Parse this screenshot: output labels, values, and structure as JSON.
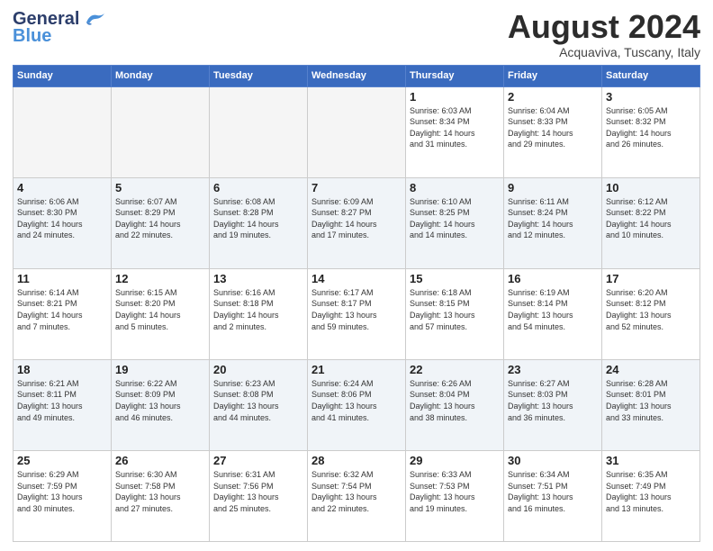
{
  "logo": {
    "line1": "General",
    "line2": "Blue"
  },
  "header": {
    "title": "August 2024",
    "subtitle": "Acquaviva, Tuscany, Italy"
  },
  "weekdays": [
    "Sunday",
    "Monday",
    "Tuesday",
    "Wednesday",
    "Thursday",
    "Friday",
    "Saturday"
  ],
  "weeks": [
    [
      {
        "day": "",
        "info": ""
      },
      {
        "day": "",
        "info": ""
      },
      {
        "day": "",
        "info": ""
      },
      {
        "day": "",
        "info": ""
      },
      {
        "day": "1",
        "info": "Sunrise: 6:03 AM\nSunset: 8:34 PM\nDaylight: 14 hours\nand 31 minutes."
      },
      {
        "day": "2",
        "info": "Sunrise: 6:04 AM\nSunset: 8:33 PM\nDaylight: 14 hours\nand 29 minutes."
      },
      {
        "day": "3",
        "info": "Sunrise: 6:05 AM\nSunset: 8:32 PM\nDaylight: 14 hours\nand 26 minutes."
      }
    ],
    [
      {
        "day": "4",
        "info": "Sunrise: 6:06 AM\nSunset: 8:30 PM\nDaylight: 14 hours\nand 24 minutes."
      },
      {
        "day": "5",
        "info": "Sunrise: 6:07 AM\nSunset: 8:29 PM\nDaylight: 14 hours\nand 22 minutes."
      },
      {
        "day": "6",
        "info": "Sunrise: 6:08 AM\nSunset: 8:28 PM\nDaylight: 14 hours\nand 19 minutes."
      },
      {
        "day": "7",
        "info": "Sunrise: 6:09 AM\nSunset: 8:27 PM\nDaylight: 14 hours\nand 17 minutes."
      },
      {
        "day": "8",
        "info": "Sunrise: 6:10 AM\nSunset: 8:25 PM\nDaylight: 14 hours\nand 14 minutes."
      },
      {
        "day": "9",
        "info": "Sunrise: 6:11 AM\nSunset: 8:24 PM\nDaylight: 14 hours\nand 12 minutes."
      },
      {
        "day": "10",
        "info": "Sunrise: 6:12 AM\nSunset: 8:22 PM\nDaylight: 14 hours\nand 10 minutes."
      }
    ],
    [
      {
        "day": "11",
        "info": "Sunrise: 6:14 AM\nSunset: 8:21 PM\nDaylight: 14 hours\nand 7 minutes."
      },
      {
        "day": "12",
        "info": "Sunrise: 6:15 AM\nSunset: 8:20 PM\nDaylight: 14 hours\nand 5 minutes."
      },
      {
        "day": "13",
        "info": "Sunrise: 6:16 AM\nSunset: 8:18 PM\nDaylight: 14 hours\nand 2 minutes."
      },
      {
        "day": "14",
        "info": "Sunrise: 6:17 AM\nSunset: 8:17 PM\nDaylight: 13 hours\nand 59 minutes."
      },
      {
        "day": "15",
        "info": "Sunrise: 6:18 AM\nSunset: 8:15 PM\nDaylight: 13 hours\nand 57 minutes."
      },
      {
        "day": "16",
        "info": "Sunrise: 6:19 AM\nSunset: 8:14 PM\nDaylight: 13 hours\nand 54 minutes."
      },
      {
        "day": "17",
        "info": "Sunrise: 6:20 AM\nSunset: 8:12 PM\nDaylight: 13 hours\nand 52 minutes."
      }
    ],
    [
      {
        "day": "18",
        "info": "Sunrise: 6:21 AM\nSunset: 8:11 PM\nDaylight: 13 hours\nand 49 minutes."
      },
      {
        "day": "19",
        "info": "Sunrise: 6:22 AM\nSunset: 8:09 PM\nDaylight: 13 hours\nand 46 minutes."
      },
      {
        "day": "20",
        "info": "Sunrise: 6:23 AM\nSunset: 8:08 PM\nDaylight: 13 hours\nand 44 minutes."
      },
      {
        "day": "21",
        "info": "Sunrise: 6:24 AM\nSunset: 8:06 PM\nDaylight: 13 hours\nand 41 minutes."
      },
      {
        "day": "22",
        "info": "Sunrise: 6:26 AM\nSunset: 8:04 PM\nDaylight: 13 hours\nand 38 minutes."
      },
      {
        "day": "23",
        "info": "Sunrise: 6:27 AM\nSunset: 8:03 PM\nDaylight: 13 hours\nand 36 minutes."
      },
      {
        "day": "24",
        "info": "Sunrise: 6:28 AM\nSunset: 8:01 PM\nDaylight: 13 hours\nand 33 minutes."
      }
    ],
    [
      {
        "day": "25",
        "info": "Sunrise: 6:29 AM\nSunset: 7:59 PM\nDaylight: 13 hours\nand 30 minutes."
      },
      {
        "day": "26",
        "info": "Sunrise: 6:30 AM\nSunset: 7:58 PM\nDaylight: 13 hours\nand 27 minutes."
      },
      {
        "day": "27",
        "info": "Sunrise: 6:31 AM\nSunset: 7:56 PM\nDaylight: 13 hours\nand 25 minutes."
      },
      {
        "day": "28",
        "info": "Sunrise: 6:32 AM\nSunset: 7:54 PM\nDaylight: 13 hours\nand 22 minutes."
      },
      {
        "day": "29",
        "info": "Sunrise: 6:33 AM\nSunset: 7:53 PM\nDaylight: 13 hours\nand 19 minutes."
      },
      {
        "day": "30",
        "info": "Sunrise: 6:34 AM\nSunset: 7:51 PM\nDaylight: 13 hours\nand 16 minutes."
      },
      {
        "day": "31",
        "info": "Sunrise: 6:35 AM\nSunset: 7:49 PM\nDaylight: 13 hours\nand 13 minutes."
      }
    ]
  ]
}
